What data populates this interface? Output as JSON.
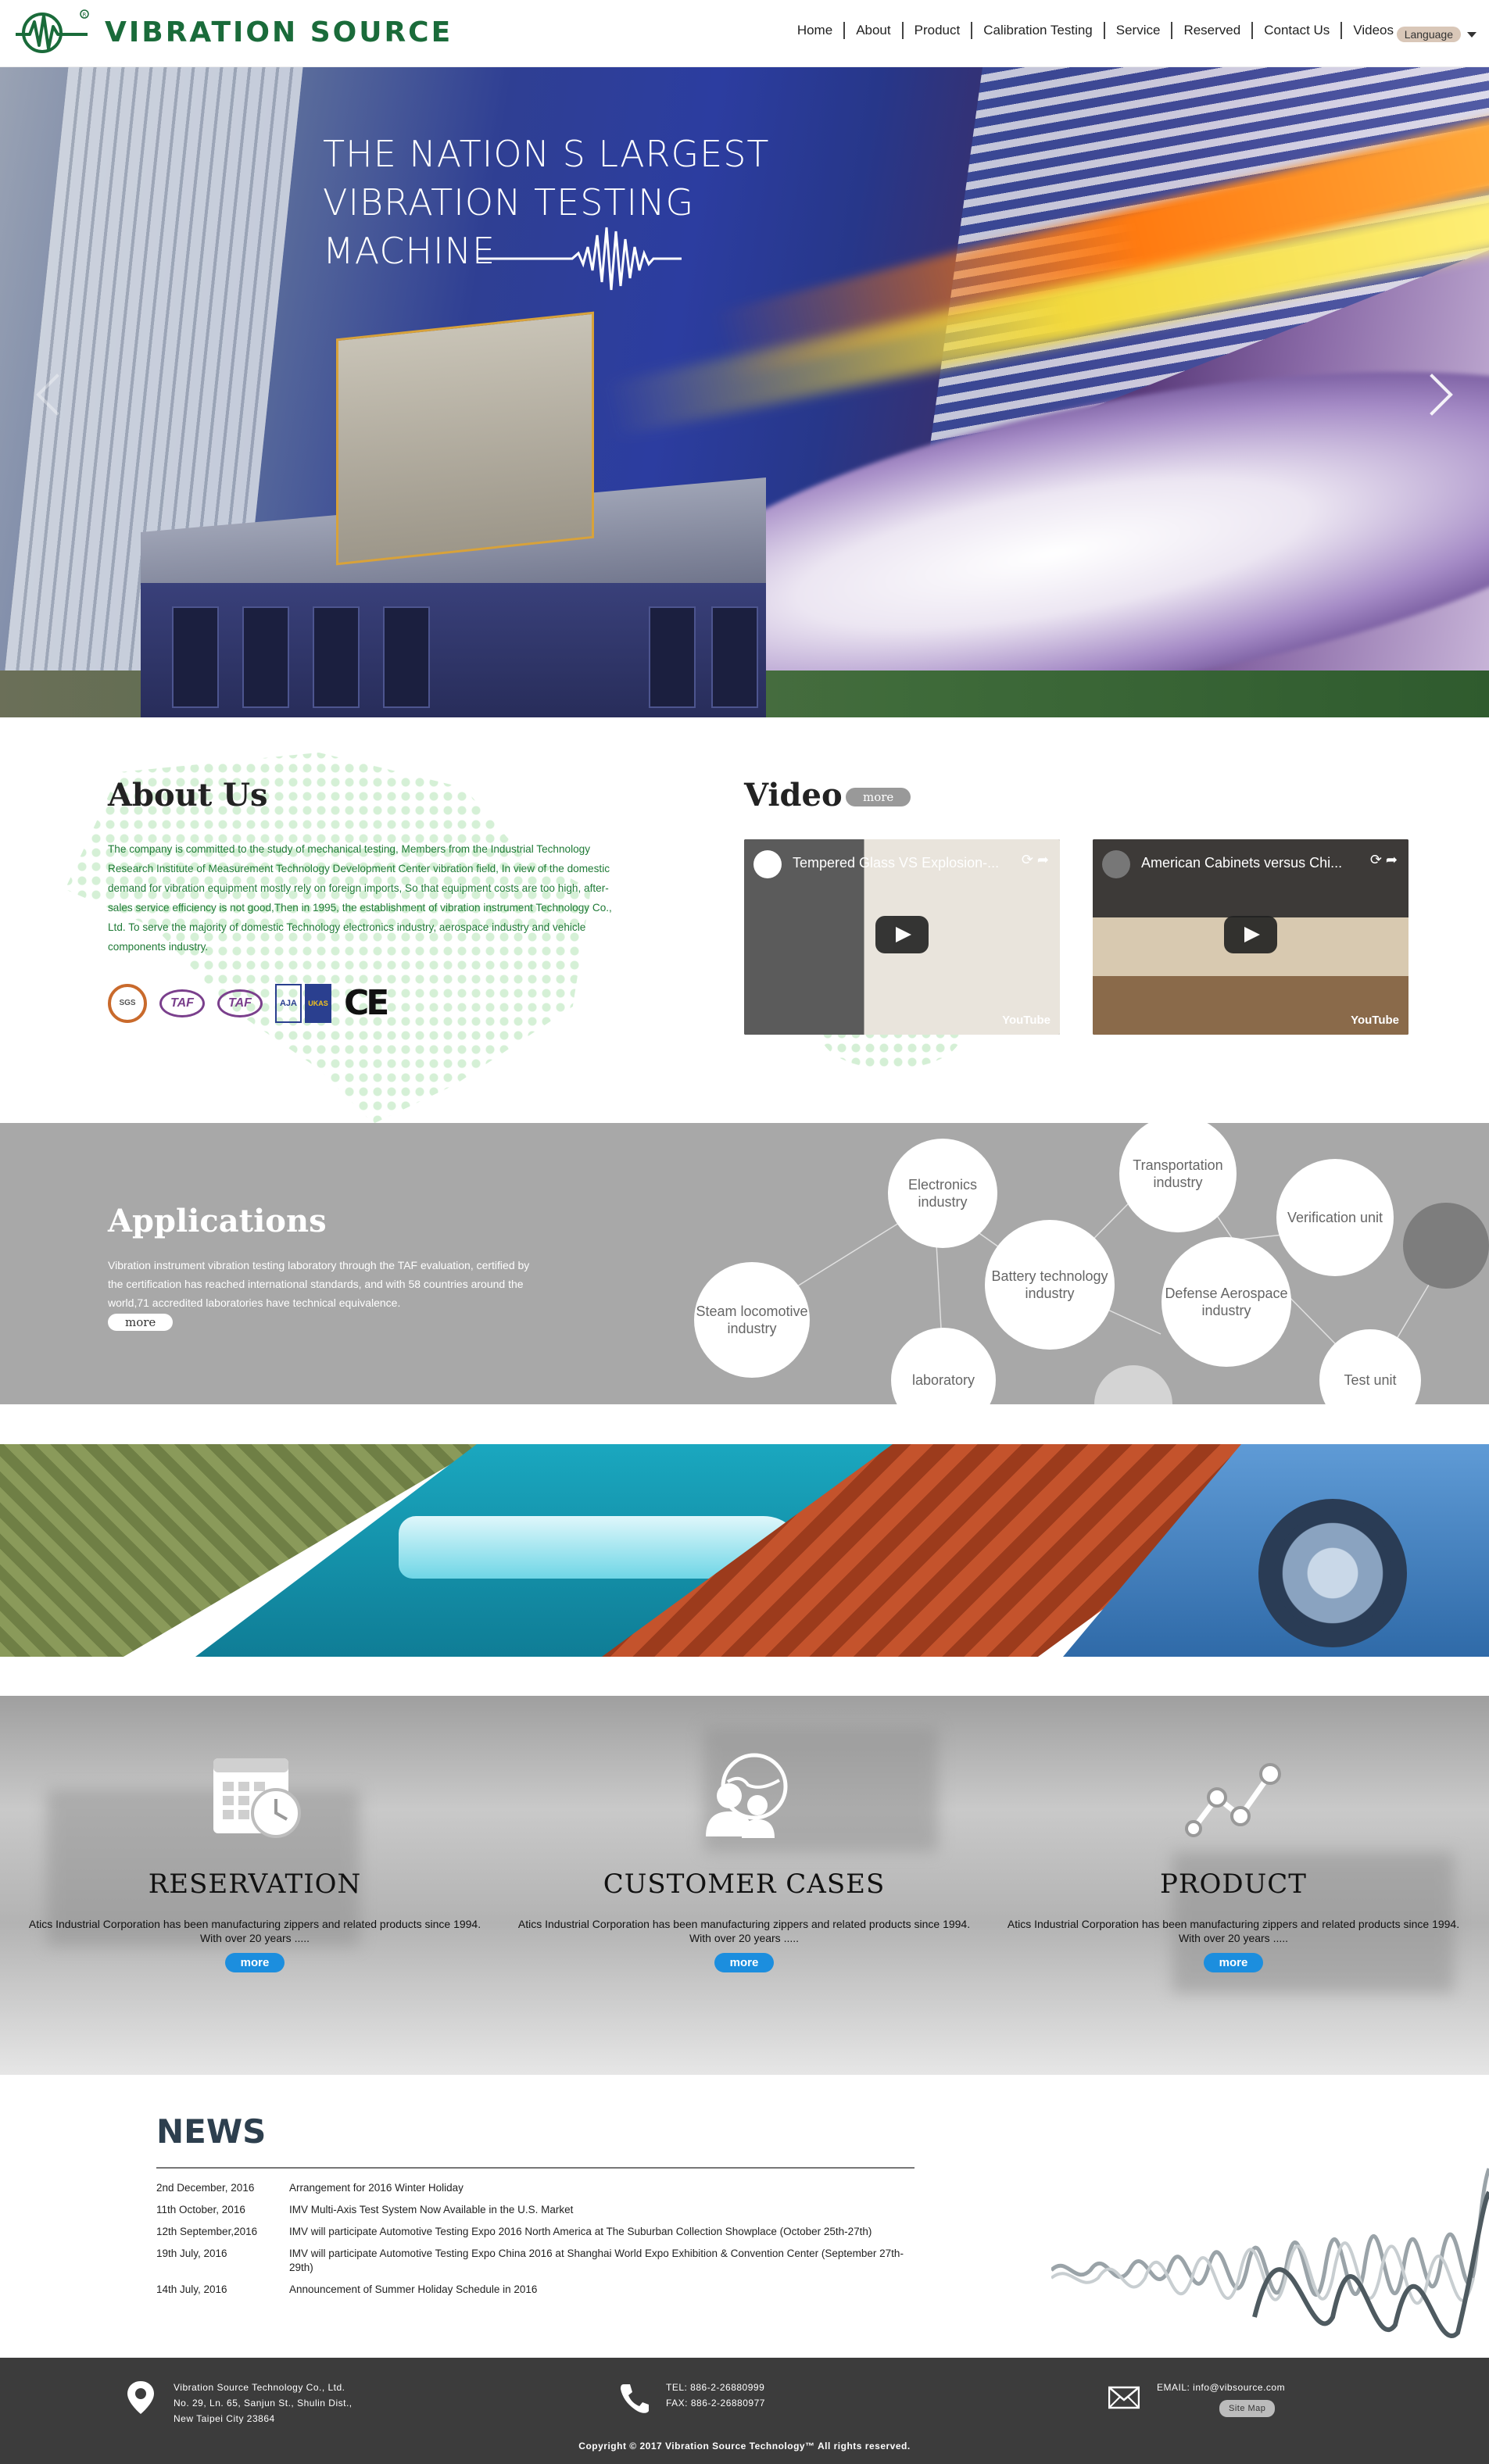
{
  "header": {
    "brand": "VIBRATION SOURCE",
    "nav": [
      "Home",
      "About",
      "Product",
      "Calibration Testing",
      "Service",
      "Reserved",
      "Contact Us",
      "Videos"
    ],
    "language": "Language"
  },
  "hero": {
    "line1": "THE NATION S LARGEST",
    "line2": "VIBRATION TESTING",
    "line3": "MACHINE"
  },
  "about": {
    "title": "About Us",
    "text": "The company is committed to the study of mechanical testing, Members from the Industrial Technology Research Institute of Measurement Technology Development Center vibration field, In view of the domestic demand for vibration equipment mostly rely on foreign imports, So that equipment costs are too high, after-sales service efficiency is not good,Then in 1995, the establishment of vibration instrument Technology Co., Ltd. To serve the majority of domestic Technology electronics industry, aerospace industry and vehicle components industry.",
    "certs": [
      "SGS",
      "TAF",
      "TAF",
      "AJA",
      "UKAS",
      "CE"
    ]
  },
  "video": {
    "title": "Video",
    "more": "more",
    "videos": [
      {
        "title": "Tempered Glass VS Explosion-...",
        "badge": "YouTube"
      },
      {
        "title": "American Cabinets versus Chi...",
        "badge": "YouTube"
      }
    ]
  },
  "applications": {
    "title": "Applications",
    "text": "Vibration instrument vibration testing laboratory through the TAF evaluation, certified by the certification has reached international standards, and with 58 countries around the world,71 accredited laboratories have technical equivalence.",
    "more": "more",
    "bubbles": {
      "electronics": "Electronics industry",
      "transportation": "Transportation industry",
      "verification": "Verification unit",
      "battery": "Battery technology industry",
      "defense": "Defense Aerospace industry",
      "steam": "Steam locomotive industry",
      "laboratory": "laboratory",
      "test": "Test unit"
    }
  },
  "services": [
    {
      "title": "RESERVATION",
      "text": "Atics Industrial Corporation has been manufacturing zippers and related products since 1994. With over 20 years .....",
      "more": "more",
      "icon": "calendar-clock-icon"
    },
    {
      "title": "CUSTOMER CASES",
      "text": "Atics Industrial Corporation has been manufacturing zippers and related products since 1994. With over 20 years .....",
      "more": "more",
      "icon": "users-globe-icon"
    },
    {
      "title": "PRODUCT",
      "text": "Atics Industrial Corporation has been manufacturing zippers and related products since 1994. With over 20 years .....",
      "more": "more",
      "icon": "line-chart-icon"
    }
  ],
  "news": {
    "title": "NEWS",
    "items": [
      {
        "date": "2nd December, 2016",
        "text": "Arrangement for 2016 Winter Holiday"
      },
      {
        "date": "11th October, 2016",
        "text": "IMV Multi-Axis Test System Now Available in the U.S. Market"
      },
      {
        "date": "12th September,2016",
        "text": "IMV will participate Automotive Testing Expo 2016 North America at The Suburban Collection Showplace (October 25th-27th)"
      },
      {
        "date": "19th July, 2016",
        "text": "IMV will participate Automotive Testing Expo China 2016 at Shanghai World Expo Exhibition & Convention Center (September 27th-29th)"
      },
      {
        "date": "14th July, 2016",
        "text": "Announcement of Summer Holiday Schedule in 2016"
      }
    ]
  },
  "footer": {
    "company": "Vibration Source Technology Co., Ltd.",
    "address1": "No. 29, Ln. 65, Sanjun St., Shulin Dist.,",
    "address2": "New Taipei City 23864",
    "tel": "TEL: 886-2-26880999",
    "fax": "FAX: 886-2-26880977",
    "email": "EMAIL: info@vibsource.com",
    "sitemap": "Site Map",
    "copyright": "Copyright © 2017 Vibration Source Technology™ All rights reserved."
  },
  "colors": {
    "brand_green": "#1a6b3a",
    "about_text_green": "#1f7a36",
    "apps_gray": "#a8a8a8",
    "service_blue": "#1c8ede",
    "footer_dark": "#3c3c3c"
  }
}
